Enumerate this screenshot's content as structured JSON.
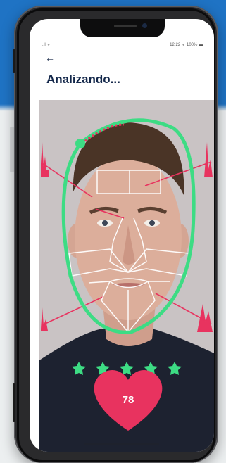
{
  "screen": {
    "title": "Analizando...",
    "back_glyph": "←",
    "status_bar": {
      "left": "..l ᯤ",
      "right": "12:22 ᯤ 100% ▬"
    }
  },
  "analysis": {
    "score": "78",
    "stars": 5
  },
  "colors": {
    "background_blue": "#1f73c4",
    "title": "#14284b",
    "accent_green": "#3ddc84",
    "accent_pink": "#e8335f"
  },
  "icons": [
    "back-arrow-icon",
    "star-icon",
    "heart-icon"
  ]
}
